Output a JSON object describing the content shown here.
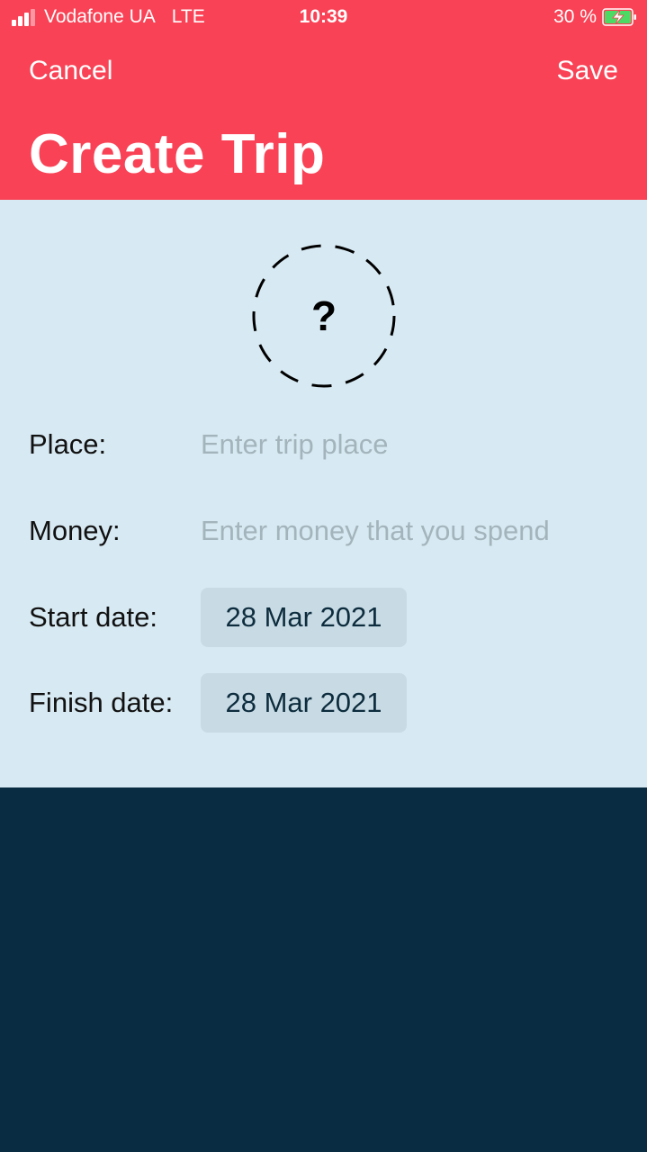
{
  "status_bar": {
    "carrier": "Vodafone UA",
    "network": "LTE",
    "time": "10:39",
    "battery": "30 %",
    "signal_bars": 3,
    "signal_bars_total": 4
  },
  "nav": {
    "cancel_label": "Cancel",
    "save_label": "Save",
    "title": "Create Trip"
  },
  "photo_picker": {
    "icon": "question-mark-icon",
    "glyph": "?"
  },
  "form": {
    "place": {
      "label": "Place:",
      "value": "",
      "placeholder": "Enter trip place"
    },
    "money": {
      "label": "Money:",
      "value": "",
      "placeholder": "Enter money that you spend"
    },
    "start_date": {
      "label": "Start date:",
      "value": "28 Mar 2021"
    },
    "finish_date": {
      "label": "Finish date:",
      "value": "28 Mar 2021"
    }
  },
  "colors": {
    "header": "#f94255",
    "form_background": "#d7e9f2",
    "date_pill": "#c8dbe5",
    "bottom_background": "#0a2c42",
    "battery_charge": "#4cd964"
  }
}
